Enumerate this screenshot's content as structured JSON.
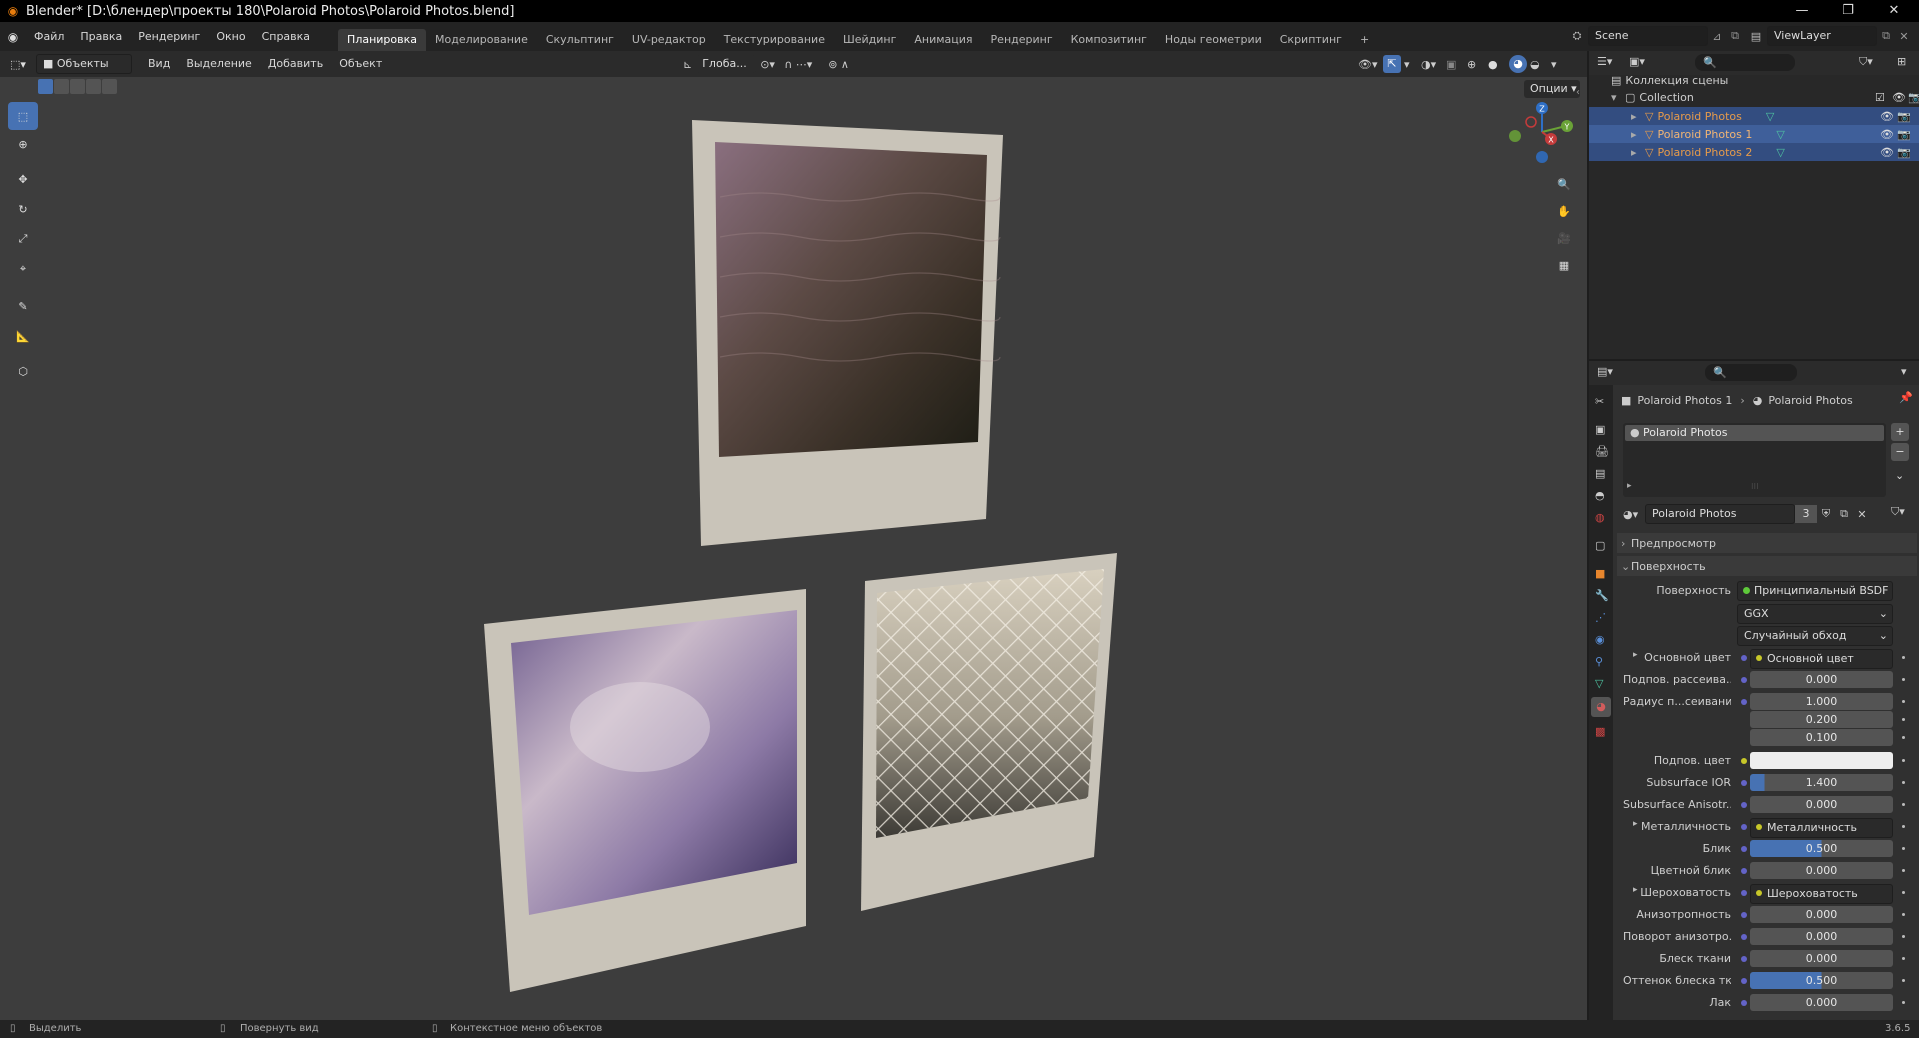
{
  "app": {
    "title": "Blender* [D:\\блендер\\проекты 180\\Polaroid Photos\\Polaroid Photos.blend]",
    "minimize": "—",
    "maximize": "❐",
    "close": "✕"
  },
  "menu": [
    "Файл",
    "Правка",
    "Рендеринг",
    "Окно",
    "Справка"
  ],
  "workspaces": {
    "active_index": 0,
    "tabs": [
      "Планировка",
      "Моделирование",
      "Скульптинг",
      "UV-редактор",
      "Текстурирование",
      "Шейдинг",
      "Анимация",
      "Рендеринг",
      "Композитинг",
      "Ноды геометрии",
      "Скриптинг"
    ],
    "add": "+"
  },
  "scene": {
    "label": "Scene",
    "viewlayer": "ViewLayer"
  },
  "viewport_header": {
    "mode": "Объекты",
    "menus": [
      "Вид",
      "Выделение",
      "Добавить",
      "Объект"
    ],
    "orientation": "Глоба...",
    "options": "Опции"
  },
  "outliner": {
    "scene_collection": "Коллекция сцены",
    "collection": "Collection",
    "objects": [
      "Polaroid Photos",
      "Polaroid Photos 1",
      "Polaroid Photos 2"
    ],
    "object_color": "#e79b4a",
    "selected_color": "#334d80"
  },
  "properties": {
    "breadcrumb_object": "Polaroid Photos 1",
    "breadcrumb_material": "Polaroid Photos",
    "slot": "Polaroid Photos",
    "material_name": "Polaroid Photos",
    "users": "3",
    "panels": {
      "preview": "Предпросмотр",
      "surface": "Поверхность"
    },
    "surface_label": "Поверхность",
    "surface_value": "Принципиальный BSDF",
    "distribution": "GGX",
    "subsurface_method": "Случайный обход",
    "fields": [
      {
        "label": "Основной цвет",
        "value": "Основной цвет",
        "kind": "link",
        "expand": true
      },
      {
        "label": "Подпов. рассеива...",
        "value": "0.000",
        "kind": "num"
      },
      {
        "label": "Радиус п...сеивания",
        "value": "1.000",
        "kind": "num"
      },
      {
        "label": "",
        "value": "0.200",
        "kind": "num"
      },
      {
        "label": "",
        "value": "0.100",
        "kind": "num"
      },
      {
        "label": "Подпов. цвет",
        "value": "",
        "kind": "color"
      },
      {
        "label": "Subsurface IOR",
        "value": "1.400",
        "kind": "num",
        "fill": 0.1
      },
      {
        "label": "Subsurface Anisotr...",
        "value": "0.000",
        "kind": "num"
      },
      {
        "label": "Металличность",
        "value": "Металличность",
        "kind": "link",
        "expand": true
      },
      {
        "label": "Блик",
        "value": "0.500",
        "kind": "num",
        "fill": 0.5
      },
      {
        "label": "Цветной блик",
        "value": "0.000",
        "kind": "num"
      },
      {
        "label": "Шероховатость",
        "value": "Шероховатость",
        "kind": "link",
        "expand": true
      },
      {
        "label": "Анизотропность",
        "value": "0.000",
        "kind": "num"
      },
      {
        "label": "Поворот анизотро...",
        "value": "0.000",
        "kind": "num"
      },
      {
        "label": "Блеск ткани",
        "value": "0.000",
        "kind": "num"
      },
      {
        "label": "Оттенок блеска тк...",
        "value": "0.500",
        "kind": "num",
        "fill": 0.5
      },
      {
        "label": "Лак",
        "value": "0.000",
        "kind": "num"
      }
    ]
  },
  "gizmo": {
    "x": "X",
    "y": "Y",
    "z": "Z"
  },
  "statusbar": {
    "select": "Выделить",
    "rotate": "Повернуть вид",
    "context": "Контекстное меню объектов",
    "version": "3.6.5"
  }
}
